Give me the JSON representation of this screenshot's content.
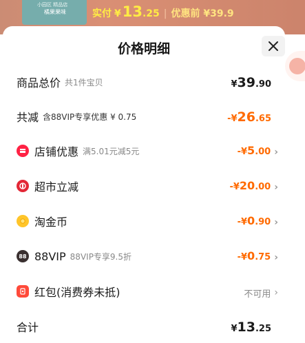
{
  "banner": {
    "thumb_line1": "小园区 精品店",
    "thumb_line2": "橘果果味",
    "price_prefix": "实付",
    "currency": "¥",
    "price_int": "13",
    "price_dec": ".25",
    "separator": "|",
    "original_label": "优惠前 ¥39.9"
  },
  "sheet": {
    "title": "价格明细",
    "close_icon": "close-icon"
  },
  "rows": [
    {
      "label": "商品总价",
      "sub": "共1件宝贝",
      "sym": "¥",
      "int": "39",
      "dec": ".90",
      "color": "black"
    },
    {
      "label": "共减",
      "sub": "含88VIP专享优惠 ¥ 0.75",
      "sym": "-¥",
      "int": "26",
      "dec": ".65",
      "color": "orange"
    },
    {
      "label": "店铺优惠",
      "sub": "满5.01元减5元",
      "sym": "-¥",
      "int": "5",
      "dec": ".00",
      "color": "orange",
      "icon": "store-icon",
      "chevron": "›"
    },
    {
      "label": "超市立减",
      "sub": "",
      "sym": "-¥",
      "int": "20",
      "dec": ".00",
      "color": "orange",
      "icon": "supermarket-icon",
      "chevron": "›"
    },
    {
      "label": "淘金币",
      "sub": "",
      "sym": "-¥",
      "int": "0",
      "dec": ".90",
      "color": "orange",
      "icon": "coin-icon",
      "chevron": "›"
    },
    {
      "label": "88VIP",
      "sub": "88VIP专享9.5折",
      "sym": "-¥",
      "int": "0",
      "dec": ".75",
      "color": "orange",
      "icon": "vip-88-icon",
      "icon_text": "88",
      "chevron": "›"
    },
    {
      "label": "红包(消费券未抵)",
      "sub": "",
      "status": "不可用",
      "icon": "red-packet-icon",
      "chevron": "›"
    },
    {
      "label": "合计",
      "sub": "",
      "sym": "¥",
      "int": "13",
      "dec": ".25",
      "color": "black"
    }
  ],
  "colors": {
    "accent_orange": "#ff6a00",
    "banner_yellow": "#ffeb3b",
    "text_dark": "#1a1a1a",
    "text_gray": "#888888"
  }
}
